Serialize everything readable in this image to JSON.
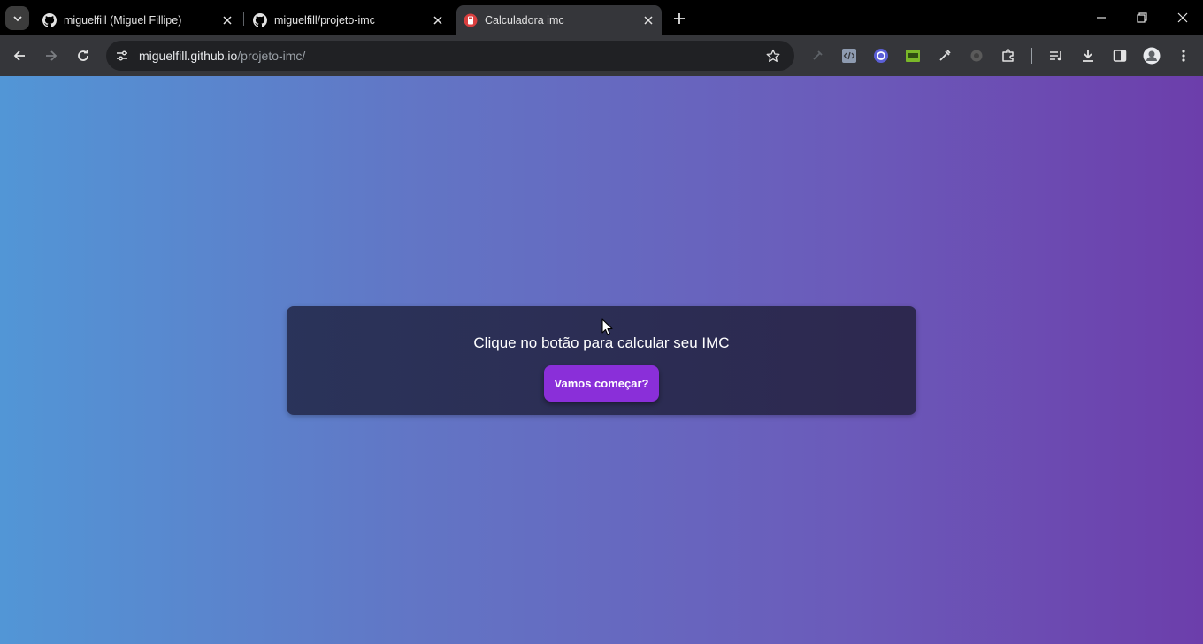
{
  "browser": {
    "tabs": [
      {
        "title": "miguelfill (Miguel Fillipe)",
        "icon": "github-icon",
        "active": false
      },
      {
        "title": "miguelfill/projeto-imc",
        "icon": "github-icon",
        "active": false
      },
      {
        "title": "Calculadora imc",
        "icon": "calculator-icon",
        "active": true
      }
    ],
    "address": {
      "host": "miguelfill.github.io",
      "path": "/projeto-imc/"
    },
    "extensions": [
      "pin-icon",
      "code-extension-icon",
      "circle-extension-icon",
      "css-extension-icon",
      "eyedropper-icon",
      "grey-extension-icon",
      "puzzle-icon",
      "media-icon",
      "download-icon",
      "side-panel-icon",
      "profile-avatar",
      "menu-icon"
    ]
  },
  "page": {
    "prompt": "Clique no botão para calcular seu IMC",
    "button_label": "Vamos começar?",
    "accent_color": "#8a2fd9"
  }
}
